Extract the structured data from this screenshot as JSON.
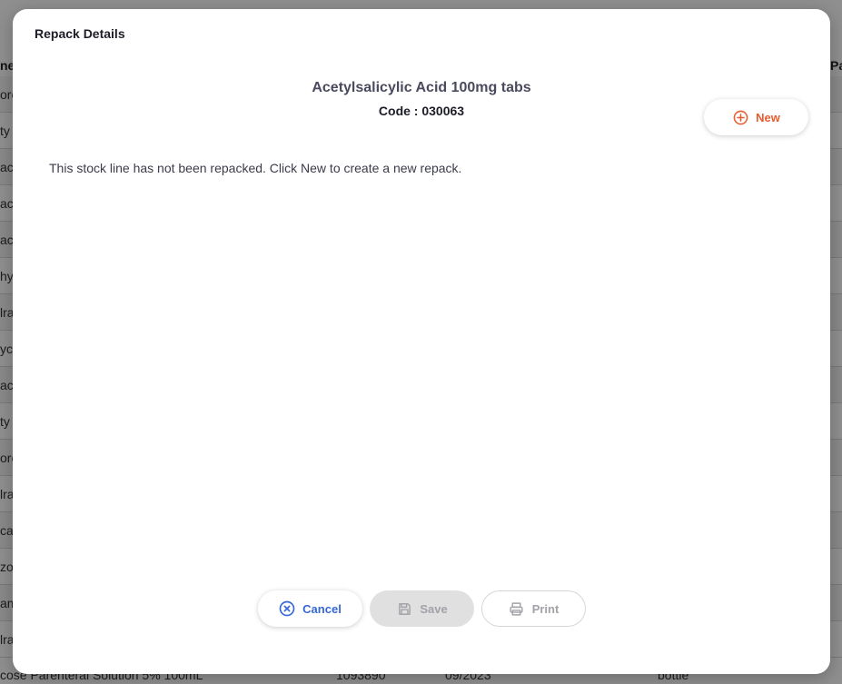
{
  "background": {
    "header_fragments": [
      "ne",
      "Pa"
    ],
    "row_fragments": [
      "oro",
      "ty",
      "ac",
      "ac",
      "ac",
      "hy",
      "lra",
      "yc",
      "ac",
      "ty",
      "oro",
      "lra",
      "ca",
      "zo",
      "am",
      "lra"
    ],
    "bottom_row": {
      "name": "cose Parenteral Solution 5% 100mL",
      "code": "1093890",
      "expiry": "09/2023",
      "unit": "bottle"
    }
  },
  "modal": {
    "title": "Repack Details",
    "item_name": "Acetylsalicylic Acid 100mg tabs",
    "code_label": "Code :",
    "code_value": "030063",
    "empty_message": "This stock line has not been repacked. Click New to create a new repack.",
    "new_button": {
      "label": "New",
      "icon": "plus-circle-icon",
      "color": "#e95c30"
    },
    "cancel_button": {
      "label": "Cancel",
      "icon": "x-circle-icon",
      "color": "#3568d4"
    },
    "save_button": {
      "label": "Save",
      "icon": "save-icon",
      "disabled": true
    },
    "print_button": {
      "label": "Print",
      "icon": "printer-icon",
      "disabled": true
    }
  }
}
